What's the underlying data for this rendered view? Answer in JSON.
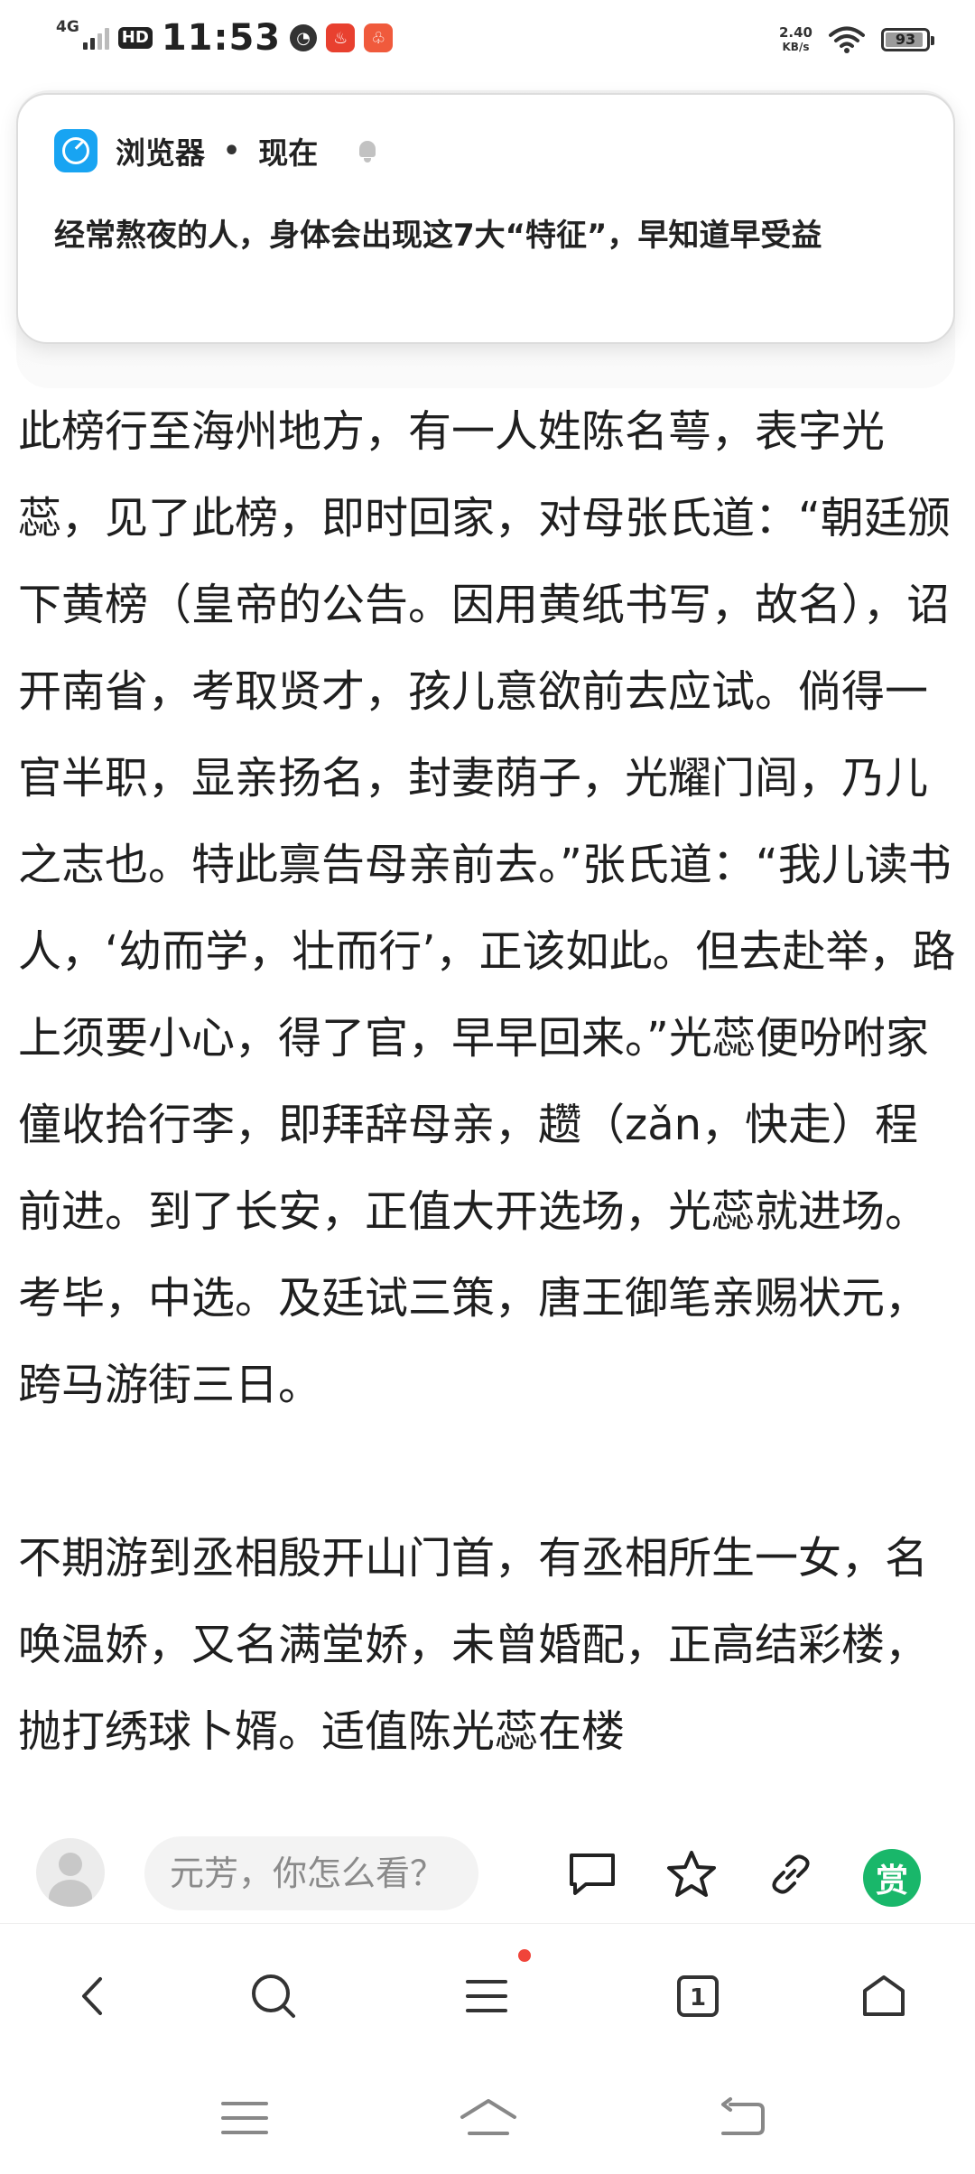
{
  "status_bar": {
    "network": "4G",
    "hd": "HD",
    "time": "11:53",
    "net_speed_value": "2.40",
    "net_speed_unit": "KB/s",
    "battery": "93",
    "battery_level": 0.93
  },
  "notification": {
    "app": "浏览器",
    "separator": "•",
    "time": "现在",
    "text": "经常熬夜的人，身体会出现这7大“特征”，早知道早受益"
  },
  "article": {
    "paragraphs": [
      "此榜行至海州地方，有一人姓陈名萼，表字光蕊，见了此榜，即时回家，对母张氏道：“朝廷颁下黄榜（皇帝的公告。因用黄纸书写，故名），诏开南省，考取贤才，孩儿意欲前去应试。倘得一官半职，显亲扬名，封妻荫子，光耀门闾，乃儿之志也。特此禀告母亲前去。”张氏道：“我儿读书人，‘幼而学，壮而行’，正该如此。但去赴举，路上须要小心，得了官，早早回来。”光蕊便吩咐家僮收拾行李，即拜辞母亲，趱（zǎn，快走）程前进。到了长安，正值大开选场，光蕊就进场。考毕，中选。及廷试三策，唐王御笔亲赐状元，跨马游街三日。",
      "不期游到丞相殷开山门首，有丞相所生一女，名唤温娇，又名满堂娇，未曾婚配，正高结彩楼，抛打绣球卜婿。适值陈光蕊在楼"
    ]
  },
  "comment_bar": {
    "placeholder": "元芳，你怎么看？",
    "reward_label": "赏"
  },
  "bottom_nav": {
    "tabs_count": "1"
  }
}
